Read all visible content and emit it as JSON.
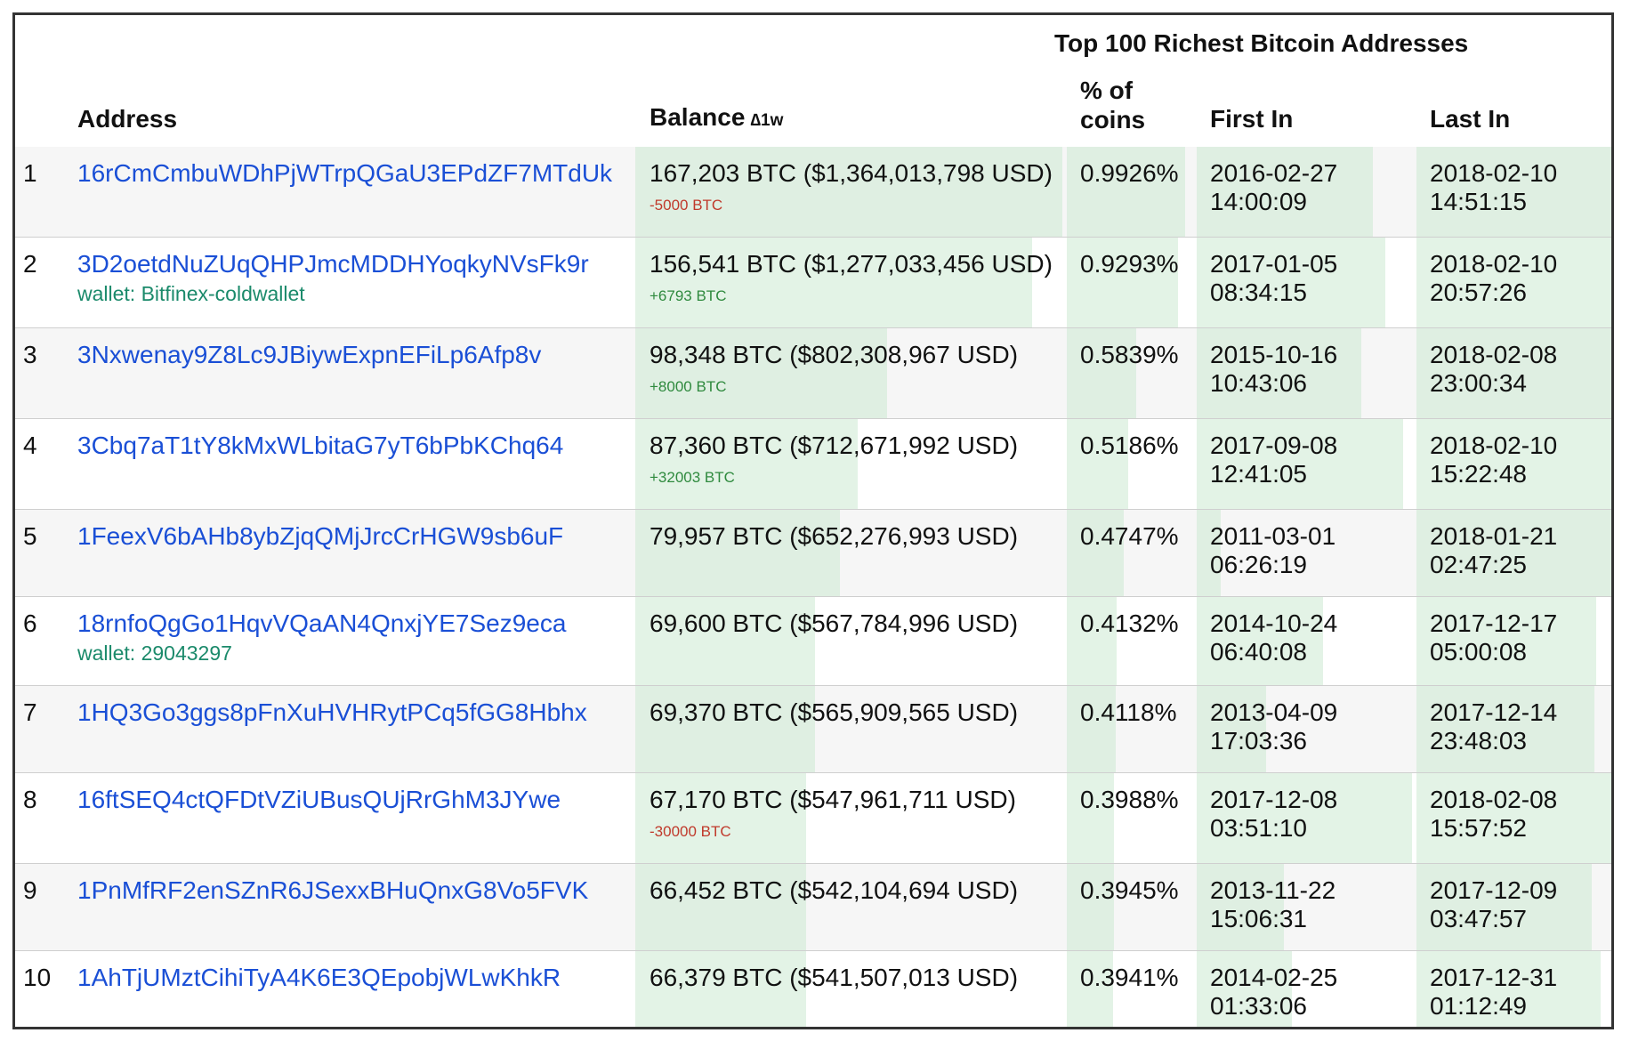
{
  "title": "Top 100 Richest Bitcoin Addresses",
  "headers": {
    "address": "Address",
    "balance": "Balance",
    "delta": "∆1w",
    "pct_line1": "% of",
    "pct_line2": "coins",
    "first_in": "First In",
    "last_in": "Last In"
  },
  "colors": {
    "link": "#1a4fd6",
    "wallet": "#1b8a6b",
    "negative_change": "#c0392b",
    "positive_change": "#2f8a3e",
    "bar_fill": "#c8e8cd"
  },
  "rows": [
    {
      "rank": "1",
      "address": "16rCmCmbuWDhPjWTrpQGaU3EPdZF7MTdUk",
      "wallet": "",
      "balance": "167,203 BTC ($1,364,013,798 USD)",
      "change": "-5000 BTC",
      "change_sign": "neg",
      "percent": "0.9926%",
      "first_date": "2016-02-27",
      "first_time": "14:00:09",
      "last_date": "2018-02-10",
      "last_time": "14:51:15",
      "balance_fill": 1.0,
      "percent_fill": 1.0,
      "first_fill": 0.81,
      "last_fill": 1.0
    },
    {
      "rank": "2",
      "address": "3D2oetdNuZUqQHPJmcMDDHYoqkyNVsFk9r",
      "wallet": "wallet: Bitfinex-coldwallet",
      "balance": "156,541 BTC ($1,277,033,456 USD)",
      "change": "+6793 BTC",
      "change_sign": "pos",
      "percent": "0.9293%",
      "first_date": "2017-01-05",
      "first_time": "08:34:15",
      "last_date": "2018-02-10",
      "last_time": "20:57:26",
      "balance_fill": 0.93,
      "percent_fill": 0.94,
      "first_fill": 0.87,
      "last_fill": 1.0
    },
    {
      "rank": "3",
      "address": "3Nxwenay9Z8Lc9JBiywExpnEFiLp6Afp8v",
      "wallet": "",
      "balance": "98,348 BTC ($802,308,967 USD)",
      "change": "+8000 BTC",
      "change_sign": "pos",
      "percent": "0.5839%",
      "first_date": "2015-10-16",
      "first_time": "10:43:06",
      "last_date": "2018-02-08",
      "last_time": "23:00:34",
      "balance_fill": 0.59,
      "percent_fill": 0.59,
      "first_fill": 0.76,
      "last_fill": 1.0
    },
    {
      "rank": "4",
      "address": "3Cbq7aT1tY8kMxWLbitaG7yT6bPbKChq64",
      "wallet": "",
      "balance": "87,360 BTC ($712,671,992 USD)",
      "change": "+32003 BTC",
      "change_sign": "pos",
      "percent": "0.5186%",
      "first_date": "2017-09-08",
      "first_time": "12:41:05",
      "last_date": "2018-02-10",
      "last_time": "15:22:48",
      "balance_fill": 0.52,
      "percent_fill": 0.52,
      "first_fill": 0.95,
      "last_fill": 1.0
    },
    {
      "rank": "5",
      "address": "1FeexV6bAHb8ybZjqQMjJrcCrHGW9sb6uF",
      "wallet": "",
      "balance": "79,957 BTC ($652,276,993 USD)",
      "change": "",
      "change_sign": "",
      "percent": "0.4747%",
      "first_date": "2011-03-01",
      "first_time": "06:26:19",
      "last_date": "2018-01-21",
      "last_time": "02:47:25",
      "balance_fill": 0.48,
      "percent_fill": 0.48,
      "first_fill": 0.11,
      "last_fill": 0.96
    },
    {
      "rank": "6",
      "address": "18rnfoQgGo1HqvVQaAN4QnxjYE7Sez9eca",
      "wallet": "wallet: 29043297",
      "balance": "69,600 BTC ($567,784,996 USD)",
      "change": "",
      "change_sign": "",
      "percent": "0.4132%",
      "first_date": "2014-10-24",
      "first_time": "06:40:08",
      "last_date": "2017-12-17",
      "last_time": "05:00:08",
      "balance_fill": 0.42,
      "percent_fill": 0.42,
      "first_fill": 0.58,
      "last_fill": 0.86
    },
    {
      "rank": "7",
      "address": "1HQ3Go3ggs8pFnXuHVHRytPCq5fGG8Hbhx",
      "wallet": "",
      "balance": "69,370 BTC ($565,909,565 USD)",
      "change": "",
      "change_sign": "",
      "percent": "0.4118%",
      "first_date": "2013-04-09",
      "first_time": "17:03:36",
      "last_date": "2017-12-14",
      "last_time": "23:48:03",
      "balance_fill": 0.42,
      "percent_fill": 0.41,
      "first_fill": 0.32,
      "last_fill": 0.85
    },
    {
      "rank": "8",
      "address": "16ftSEQ4ctQFDtVZiUBusQUjRrGhM3JYwe",
      "wallet": "",
      "balance": "67,170 BTC ($547,961,711 USD)",
      "change": "-30000 BTC",
      "change_sign": "neg",
      "percent": "0.3988%",
      "first_date": "2017-12-08",
      "first_time": "03:51:10",
      "last_date": "2018-02-08",
      "last_time": "15:57:52",
      "balance_fill": 0.4,
      "percent_fill": 0.4,
      "first_fill": 0.99,
      "last_fill": 0.98
    },
    {
      "rank": "9",
      "address": "1PnMfRF2enSZnR6JSexxBHuQnxG8Vo5FVK",
      "wallet": "",
      "balance": "66,452 BTC ($542,104,694 USD)",
      "change": "",
      "change_sign": "",
      "percent": "0.3945%",
      "first_date": "2013-11-22",
      "first_time": "15:06:31",
      "last_date": "2017-12-09",
      "last_time": "03:47:57",
      "balance_fill": 0.4,
      "percent_fill": 0.4,
      "first_fill": 0.4,
      "last_fill": 0.84
    },
    {
      "rank": "10",
      "address": "1AhTjUMztCihiTyA4K6E3QEpobjWLwKhkR",
      "wallet": "",
      "balance": "66,379 BTC ($541,507,013 USD)",
      "change": "",
      "change_sign": "",
      "percent": "0.3941%",
      "first_date": "2014-02-25",
      "first_time": "01:33:06",
      "last_date": "2017-12-31",
      "last_time": "01:12:49",
      "balance_fill": 0.4,
      "percent_fill": 0.39,
      "first_fill": 0.44,
      "last_fill": 0.88
    }
  ]
}
